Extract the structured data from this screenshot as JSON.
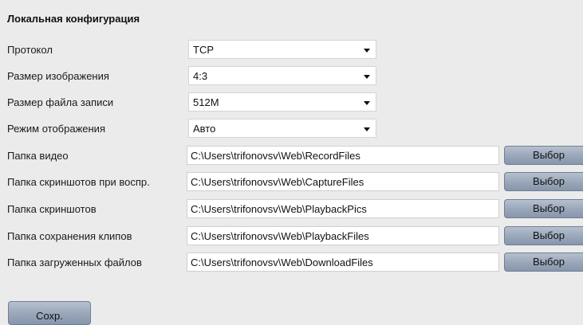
{
  "section": {
    "title": "Локальная конфигурация"
  },
  "settings": {
    "protocol": {
      "label": "Протокол",
      "value": "TCP"
    },
    "image_size": {
      "label": "Размер изображения",
      "value": "4:3"
    },
    "record_file_size": {
      "label": "Размер файла записи",
      "value": "512M"
    },
    "display_mode": {
      "label": "Режим отображения",
      "value": "Авто"
    }
  },
  "folders": {
    "video": {
      "label": "Папка видео",
      "value": "C:\\Users\\trifonovsv\\Web\\RecordFiles",
      "button": "Выбор"
    },
    "playback_snapshots": {
      "label": "Папка скриншотов при воспр.",
      "value": "C:\\Users\\trifonovsv\\Web\\CaptureFiles",
      "button": "Выбор"
    },
    "snapshots": {
      "label": "Папка скриншотов",
      "value": "C:\\Users\\trifonovsv\\Web\\PlaybackPics",
      "button": "Выбор"
    },
    "clips": {
      "label": "Папка сохранения клипов",
      "value": "C:\\Users\\trifonovsv\\Web\\PlaybackFiles",
      "button": "Выбор"
    },
    "downloads": {
      "label": "Папка загруженных файлов",
      "value": "C:\\Users\\trifonovsv\\Web\\DownloadFiles",
      "button": "Выбор"
    }
  },
  "footer": {
    "save_label": "Сохр."
  },
  "colors": {
    "background": "#ebebeb",
    "button_gradient_top": "#b6c0ce",
    "button_gradient_bottom": "#8896ab"
  },
  "icons": {
    "dropdown": "chevron-down-icon"
  }
}
